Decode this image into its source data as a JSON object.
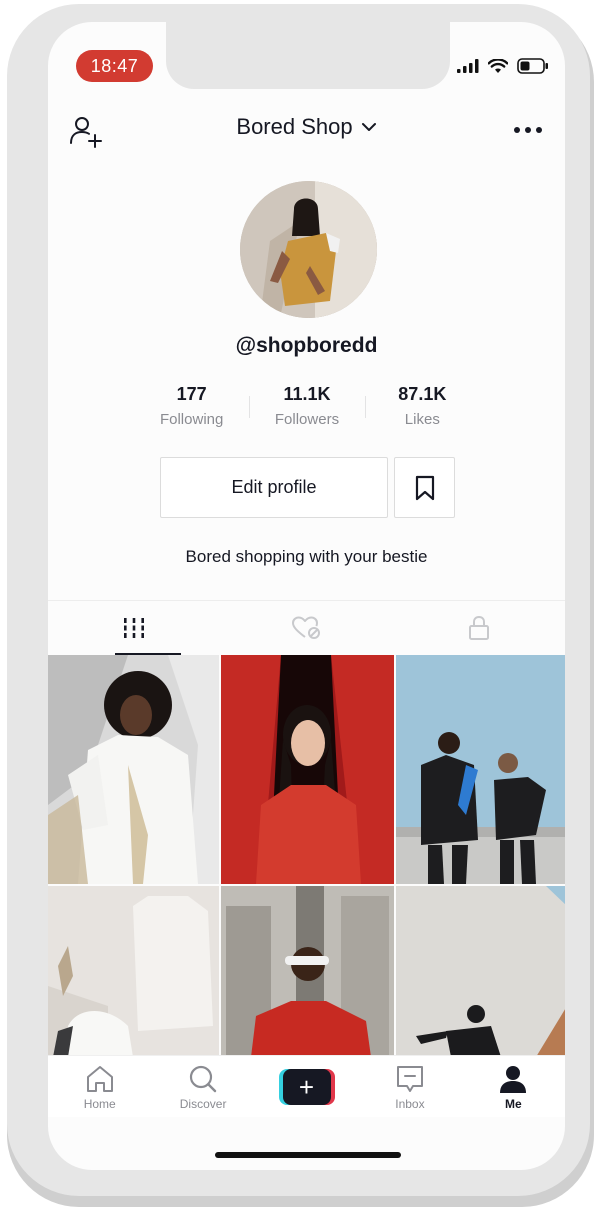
{
  "status_bar": {
    "time": "18:47",
    "icons": [
      "signal-icon",
      "wifi-icon",
      "battery-icon"
    ]
  },
  "header": {
    "account_name": "Bored Shop",
    "add_friend_icon": "person-plus-icon",
    "dropdown_icon": "chevron-down-icon",
    "more_icon": "more-horizontal-icon"
  },
  "profile": {
    "handle": "@shopboredd",
    "stats": [
      {
        "value": "177",
        "label": "Following"
      },
      {
        "value": "11.1K",
        "label": "Followers"
      },
      {
        "value": "87.1K",
        "label": "Likes"
      }
    ],
    "edit_button_label": "Edit profile",
    "bookmark_icon": "bookmark-icon",
    "bio": "Bored shopping with your bestie"
  },
  "tabs": [
    {
      "icon": "grid-icon",
      "active": true
    },
    {
      "icon": "liked-heart-icon",
      "active": false
    },
    {
      "icon": "lock-icon",
      "active": false
    }
  ],
  "bottom_nav": [
    {
      "label": "Home",
      "icon": "home-icon"
    },
    {
      "label": "Discover",
      "icon": "search-icon"
    },
    {
      "label": "",
      "icon": "plus-icon"
    },
    {
      "label": "Inbox",
      "icon": "inbox-icon"
    },
    {
      "label": "Me",
      "icon": "person-icon",
      "active": true
    }
  ],
  "colors": {
    "time_pill": "#d23b31",
    "text_primary": "#161823",
    "text_secondary": "#8a8b91",
    "accent_cyan": "#35d0e0",
    "accent_red": "#e1374a"
  }
}
